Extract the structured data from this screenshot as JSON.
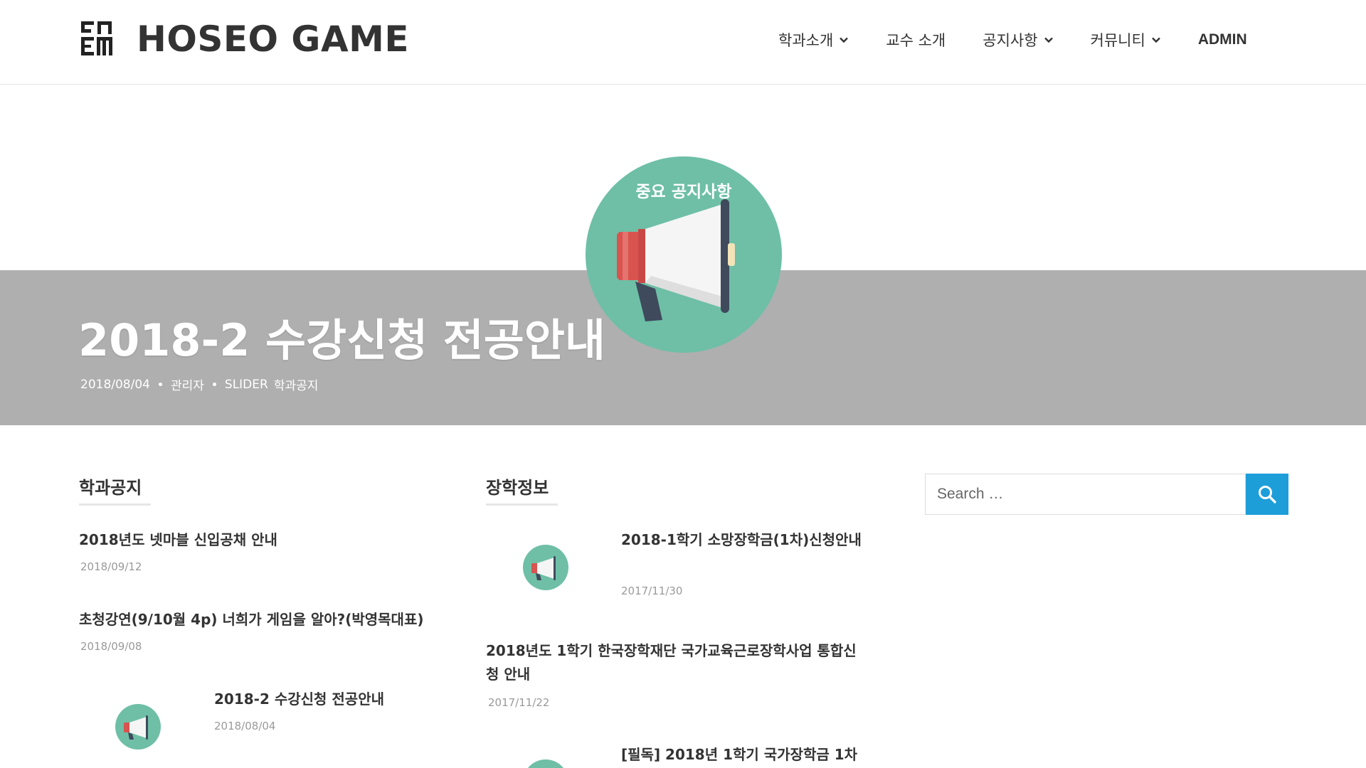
{
  "header": {
    "site_title": "HOSEO GAME",
    "nav": [
      {
        "label": "학과소개",
        "icon": "chevron-down-icon"
      },
      {
        "label": "교수 소개"
      },
      {
        "label": "공지사항",
        "icon": "chevron-down-icon"
      },
      {
        "label": "커뮤니티",
        "icon": "chevron-down-icon"
      },
      {
        "label": "ADMIN"
      }
    ]
  },
  "hero": {
    "image_text": "중요 공지사항",
    "title": "2018-2 수강신청 전공안내",
    "date": "2018/08/04",
    "author": "관리자",
    "categories": [
      "SLIDER",
      "학과공지"
    ]
  },
  "notices": {
    "title": "학과공지",
    "posts": [
      {
        "title": "2018년도 넷마블 신입공채 안내",
        "date": "2018/09/12"
      },
      {
        "title": "초청강연(9/10월 4p) 너희가 게임을 알아?(박영목대표)",
        "date": "2018/09/08"
      },
      {
        "title": "2018-2 수강신청 전공안내",
        "date": "2018/08/04"
      }
    ]
  },
  "scholarship": {
    "title": "장학정보",
    "posts": [
      {
        "title": "2018-1학기 소망장학금(1차)신청안내",
        "date": "2017/11/30"
      },
      {
        "title": "2018년도 1학기 한국장학재단 국가교육근로장학사업 통합신청 안내",
        "date": "2017/11/22"
      },
      {
        "title": "[필독] 2018년 1학기 국가장학금 1차"
      }
    ]
  },
  "search": {
    "placeholder": "Search …",
    "icon": "search-icon"
  },
  "colors": {
    "accent": "#1d9ed9",
    "hero_band": "#afafaf",
    "teal": "#6ebfa6"
  }
}
